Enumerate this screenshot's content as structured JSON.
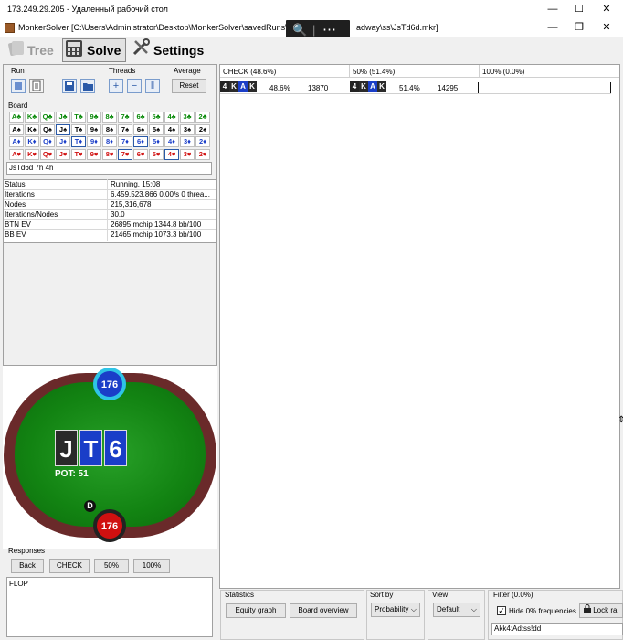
{
  "rdp": {
    "title": "173.249.29.205 - Удаленный рабочий стол"
  },
  "window": {
    "title": "MonkerSolver [C:\\Users\\Administrator\\Desktop\\MonkerSolver\\savedRuns\\3 Bet",
    "title_tail": "adway\\ss\\JsTd6d.mkr]"
  },
  "toolbar": {
    "tree": "Tree",
    "solve": "Solve",
    "settings": "Settings"
  },
  "run": {
    "label": "Run",
    "threads": "Threads",
    "average": "Average",
    "reset": "Reset"
  },
  "board": {
    "label": "Board",
    "value": "JsTd6d 7h 4h",
    "rows": [
      [
        {
          "t": "A♣",
          "c": "g"
        },
        {
          "t": "K♣",
          "c": "g"
        },
        {
          "t": "Q♣",
          "c": "g"
        },
        {
          "t": "J♣",
          "c": "g"
        },
        {
          "t": "T♣",
          "c": "g"
        },
        {
          "t": "9♣",
          "c": "g"
        },
        {
          "t": "8♣",
          "c": "g"
        },
        {
          "t": "7♣",
          "c": "g"
        },
        {
          "t": "6♣",
          "c": "g"
        },
        {
          "t": "5♣",
          "c": "g"
        },
        {
          "t": "4♣",
          "c": "g"
        },
        {
          "t": "3♣",
          "c": "g"
        },
        {
          "t": "2♣",
          "c": "g"
        }
      ],
      [
        {
          "t": "A♠",
          "c": "b"
        },
        {
          "t": "K♠",
          "c": "b"
        },
        {
          "t": "Q♠",
          "c": "b"
        },
        {
          "t": "J♠",
          "c": "b",
          "s": 1
        },
        {
          "t": "T♠",
          "c": "b"
        },
        {
          "t": "9♠",
          "c": "b"
        },
        {
          "t": "8♠",
          "c": "b"
        },
        {
          "t": "7♠",
          "c": "b"
        },
        {
          "t": "6♠",
          "c": "b"
        },
        {
          "t": "5♠",
          "c": "b"
        },
        {
          "t": "4♠",
          "c": "b"
        },
        {
          "t": "3♠",
          "c": "b"
        },
        {
          "t": "2♠",
          "c": "b"
        }
      ],
      [
        {
          "t": "A♦",
          "c": "u"
        },
        {
          "t": "K♦",
          "c": "u"
        },
        {
          "t": "Q♦",
          "c": "u"
        },
        {
          "t": "J♦",
          "c": "u"
        },
        {
          "t": "T♦",
          "c": "u",
          "s": 1
        },
        {
          "t": "9♦",
          "c": "u"
        },
        {
          "t": "8♦",
          "c": "u"
        },
        {
          "t": "7♦",
          "c": "u"
        },
        {
          "t": "6♦",
          "c": "u",
          "s": 1
        },
        {
          "t": "5♦",
          "c": "u"
        },
        {
          "t": "4♦",
          "c": "u"
        },
        {
          "t": "3♦",
          "c": "u"
        },
        {
          "t": "2♦",
          "c": "u"
        }
      ],
      [
        {
          "t": "A♥",
          "c": "r"
        },
        {
          "t": "K♥",
          "c": "r"
        },
        {
          "t": "Q♥",
          "c": "r"
        },
        {
          "t": "J♥",
          "c": "r"
        },
        {
          "t": "T♥",
          "c": "r"
        },
        {
          "t": "9♥",
          "c": "r"
        },
        {
          "t": "8♥",
          "c": "r"
        },
        {
          "t": "7♥",
          "c": "r",
          "s": 1
        },
        {
          "t": "6♥",
          "c": "r"
        },
        {
          "t": "5♥",
          "c": "r"
        },
        {
          "t": "4♥",
          "c": "r",
          "s": 1
        },
        {
          "t": "3♥",
          "c": "r"
        },
        {
          "t": "2♥",
          "c": "r"
        }
      ]
    ]
  },
  "stats": [
    {
      "k": "Status",
      "v": "Running, 15:08"
    },
    {
      "k": "Iterations",
      "v": "6,459,523,866  0.00/s 0 threa..."
    },
    {
      "k": "Nodes",
      "v": "215,316,678"
    },
    {
      "k": "Iterations/Nodes",
      "v": "30.0"
    },
    {
      "k": "BTN EV",
      "v": "26895 mchip    1344.8 bb/100"
    },
    {
      "k": "BB EV",
      "v": "21465 mchip    1073.3 bb/100"
    }
  ],
  "table": {
    "top_stack": "176",
    "bottom_stack": "176",
    "dealer": "D",
    "board": [
      "J",
      "T",
      "6"
    ],
    "pot": "POT: 51"
  },
  "responses": {
    "label": "Responses",
    "back": "Back",
    "check": "CHECK",
    "b50": "50%",
    "b100": "100%",
    "history": "FLOP"
  },
  "grid": {
    "cols": [
      {
        "label": "CHECK (48.6%)"
      },
      {
        "label": "50% (51.4%)"
      },
      {
        "label": "100% (0.0%)"
      }
    ],
    "row": {
      "c1": {
        "pct": "48.6%",
        "ev": "13870"
      },
      "c2": {
        "pct": "51.4%",
        "ev": "14295"
      }
    },
    "cards": [
      "4",
      "K",
      "A",
      "K"
    ]
  },
  "bottom": {
    "statistics": "Statistics",
    "equity": "Equity graph",
    "board_overview": "Board overview",
    "sort_by": "Sort by",
    "sort_val": "Probability",
    "view": "View",
    "view_val": "Default",
    "filter": "Filter (0.0%)",
    "hide0": "Hide 0% frequencies",
    "lock": "Lock ra",
    "filter_text": "Akk4:Ad:ss!dd"
  }
}
